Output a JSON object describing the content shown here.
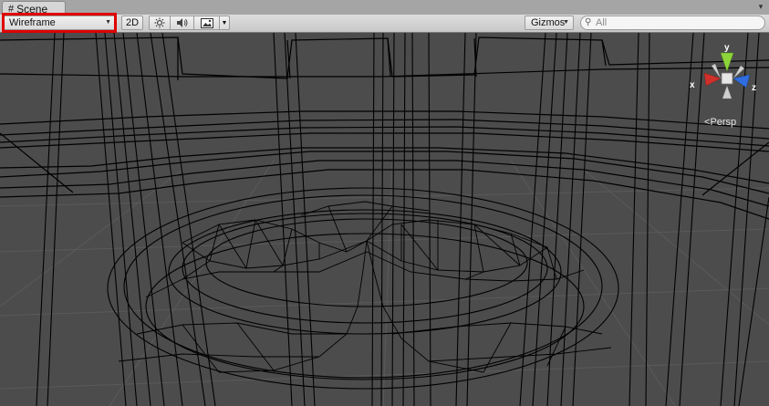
{
  "tab": {
    "label": "Scene",
    "icon": "grid-hash-icon"
  },
  "toolbar": {
    "draw_mode": "Wireframe",
    "toggle_2d": "2D",
    "lighting_icon": "sun-icon",
    "audio_icon": "speaker-icon",
    "effects_icon": "image-icon",
    "gizmos_label": "Gizmos",
    "search_placeholder": "All"
  },
  "gizmo": {
    "axes": {
      "x": "x",
      "y": "y",
      "z": "z"
    },
    "colors": {
      "x": "#d0302a",
      "y": "#8cd43a",
      "z": "#2f6de0"
    }
  },
  "view_mode_label": "Persp",
  "highlight_color": "#e00000"
}
